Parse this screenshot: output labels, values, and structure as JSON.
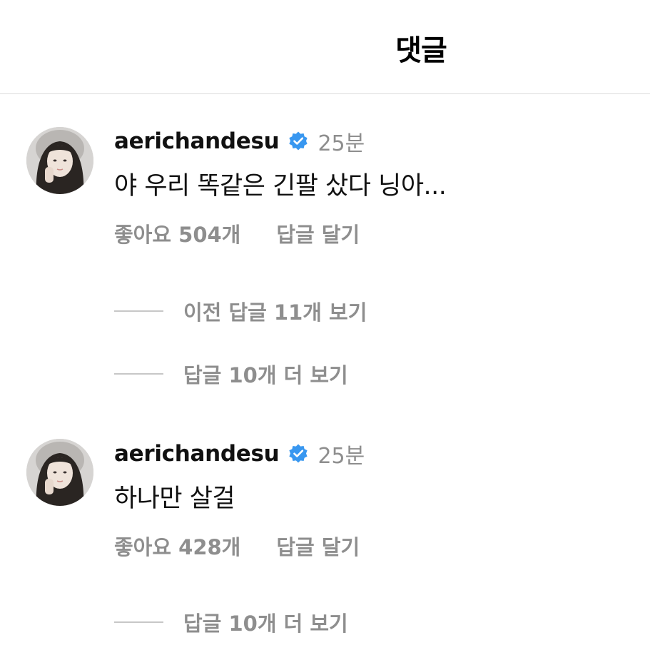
{
  "header": {
    "title": "댓글"
  },
  "comments": [
    {
      "username": "aerichandesu",
      "time": "25분",
      "text": "야 우리 똑같은 긴팔 샀다 닝아...",
      "likes": "좋아요 504개",
      "reply_label": "답글 달기",
      "view_previous_replies": "이전 답글 11개 보기",
      "view_more_replies": "답글 10개 더 보기"
    },
    {
      "username": "aerichandesu",
      "time": "25분",
      "text": "하나만 살걸",
      "likes": "좋아요 428개",
      "reply_label": "답글 달기",
      "view_more_replies": "답글 10개 더 보기"
    }
  ],
  "icons": {
    "verified": "verified-badge-icon",
    "avatar": "avatar"
  },
  "colors": {
    "verified_blue": "#3897f0",
    "secondary_text": "#8e8e8e",
    "divider": "#dbdbdb"
  }
}
